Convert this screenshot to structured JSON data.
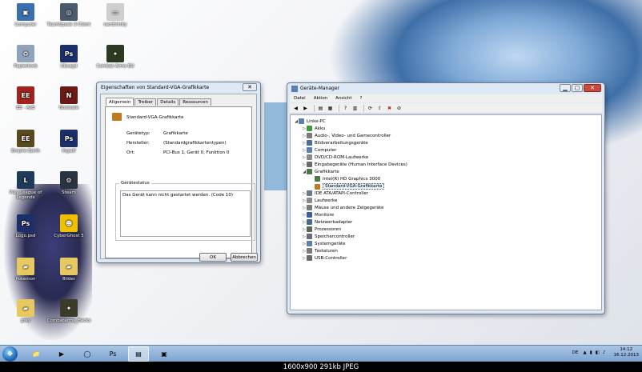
{
  "desktop": {
    "icons": [
      {
        "label": "Computer",
        "icon": "computer-icon",
        "color": "#3c6fb0",
        "glyph": "▣"
      },
      {
        "label": "TeamSpeak 3 Client",
        "icon": "teamspeak-icon",
        "color": "#4a5a6a",
        "glyph": "◎"
      },
      {
        "label": "nerdtrinity",
        "icon": "app-icon",
        "color": "#cfcfcf",
        "glyph": "▭"
      },
      {
        "label": "Papierkorb",
        "icon": "recycle-bin-icon",
        "color": "#8fa4bb",
        "glyph": "♻"
      },
      {
        "label": "Ubxsgd",
        "icon": "photoshop-file-icon",
        "color": "#1c2f6b",
        "glyph": "Ps"
      },
      {
        "label": "Combat Arms EU",
        "icon": "combat-arms-icon",
        "color": "#2d3a22",
        "glyph": "✦"
      },
      {
        "label": "EE - AoE",
        "icon": "empire-earth-icon",
        "color": "#a2231d",
        "glyph": "EE"
      },
      {
        "label": "Nosteale",
        "icon": "nostale-icon",
        "color": "#6a1a12",
        "glyph": "N"
      },
      {
        "label": "Empire Earth",
        "icon": "empire-earth-2-icon",
        "color": "#5a4a20",
        "glyph": "EE"
      },
      {
        "label": "Ihgsdf",
        "icon": "photoshop-file-icon",
        "color": "#1c2f6b",
        "glyph": "Ps"
      },
      {
        "label": "Play League of Legends",
        "icon": "league-of-legends-icon",
        "color": "#203a5a",
        "glyph": "L"
      },
      {
        "label": "Steam",
        "icon": "steam-icon",
        "color": "#2a3440",
        "glyph": "⚙"
      },
      {
        "label": "Logo.psd",
        "icon": "photoshop-file-icon",
        "color": "#1c2f6b",
        "glyph": "Ps"
      },
      {
        "label": "CyberGhost 5",
        "icon": "cyberghost-icon",
        "color": "#f0c000",
        "glyph": "☻"
      },
      {
        "label": "Pokemon",
        "icon": "folder-icon",
        "color": "#e8c860",
        "glyph": "▰"
      },
      {
        "label": "Bilder",
        "icon": "folder-icon",
        "color": "#e8c860",
        "glyph": "▰"
      },
      {
        "label": "grey",
        "icon": "folder-icon",
        "color": "#e8c860",
        "glyph": "▰"
      },
      {
        "label": "Combatarms_Hacks",
        "icon": "combat-arms-icon",
        "color": "#3b3b2a",
        "glyph": "✦"
      }
    ]
  },
  "props": {
    "title": "Eigenschaften von Standard-VGA-Grafikkarte",
    "close_glyph": "✕",
    "tabs": [
      "Allgemein",
      "Treiber",
      "Details",
      "Ressourcen"
    ],
    "device_name": "Standard-VGA-Grafikkarte",
    "rows": [
      {
        "key": "Gerätetyp:",
        "value": "Grafikkarte"
      },
      {
        "key": "Hersteller:",
        "value": "(Standardgrafikkartentypen)"
      },
      {
        "key": "Ort:",
        "value": "PCI-Bus 1, Gerät 0, Funktion 0"
      }
    ],
    "status_label": "Gerätestatus",
    "status_text": "Das Gerät kann nicht gestartet werden. (Code 10)",
    "ok_label": "OK",
    "cancel_label": "Abbrechen"
  },
  "devmgr": {
    "title": "Geräte-Manager",
    "min_glyph": "▁",
    "max_glyph": "▢",
    "close_glyph": "✕",
    "menu": [
      "Datei",
      "Aktion",
      "Ansicht",
      "?"
    ],
    "toolbar": [
      {
        "glyph": "◀",
        "icon": "back-icon"
      },
      {
        "glyph": "▶",
        "icon": "forward-icon"
      },
      {
        "glyph": "▤",
        "icon": "properties-icon"
      },
      {
        "glyph": "▦",
        "icon": "tree-icon"
      },
      {
        "glyph": "?",
        "icon": "help-icon"
      },
      {
        "glyph": "▥",
        "icon": "view-icon"
      },
      {
        "glyph": "⟳",
        "icon": "scan-icon"
      },
      {
        "glyph": "⇧",
        "icon": "update-driver-icon"
      },
      {
        "glyph": "✖",
        "icon": "uninstall-icon"
      },
      {
        "glyph": "⊘",
        "icon": "disable-icon"
      }
    ],
    "tree": [
      {
        "label": "Linke-PC",
        "level": 0,
        "arrow": "◢",
        "color": "#5a7fb0",
        "icon": "computer-icon"
      },
      {
        "label": "Akku",
        "level": 1,
        "arrow": "▷",
        "color": "#3b9b3b",
        "icon": "battery-icon"
      },
      {
        "label": "Audio-, Video- und Gamecontroller",
        "level": 1,
        "arrow": "▷",
        "color": "#7a7a7a",
        "icon": "speaker-icon"
      },
      {
        "label": "Bildverarbeitungsgeräte",
        "level": 1,
        "arrow": "▷",
        "color": "#4a6f9a",
        "icon": "camera-icon"
      },
      {
        "label": "Computer",
        "level": 1,
        "arrow": "▷",
        "color": "#5a7fb0",
        "icon": "computer-icon"
      },
      {
        "label": "DVD/CD-ROM-Laufwerke",
        "level": 1,
        "arrow": "▷",
        "color": "#8a8a8a",
        "icon": "dvd-drive-icon"
      },
      {
        "label": "Eingabegeräte (Human Interface Devices)",
        "level": 1,
        "arrow": "▷",
        "color": "#6a6a6a",
        "icon": "hid-icon"
      },
      {
        "label": "Grafikkarte",
        "level": 1,
        "arrow": "◢",
        "color": "#4a7a4a",
        "icon": "display-adapter-icon"
      },
      {
        "label": "Intel(R) HD Graphics 3000",
        "level": 2,
        "arrow": "",
        "color": "#4a7a4a",
        "icon": "display-adapter-icon"
      },
      {
        "label": "Standard-VGA-Grafikkarte",
        "level": 2,
        "arrow": "",
        "color": "#c07a20",
        "icon": "warning-device-icon"
      },
      {
        "label": "IDE ATA/ATAPI-Controller",
        "level": 1,
        "arrow": "▷",
        "color": "#6a7a8a",
        "icon": "ide-controller-icon"
      },
      {
        "label": "Laufwerke",
        "level": 1,
        "arrow": "▷",
        "color": "#8a8a8a",
        "icon": "disk-drive-icon"
      },
      {
        "label": "Mäuse und andere Zeigegeräte",
        "level": 1,
        "arrow": "▷",
        "color": "#7a7a7a",
        "icon": "mouse-icon"
      },
      {
        "label": "Monitore",
        "level": 1,
        "arrow": "▷",
        "color": "#3a5f9a",
        "icon": "monitor-icon"
      },
      {
        "label": "Netzwerkadapter",
        "level": 1,
        "arrow": "▷",
        "color": "#4a6a8a",
        "icon": "network-adapter-icon"
      },
      {
        "label": "Prozessoren",
        "level": 1,
        "arrow": "▷",
        "color": "#5a6a5a",
        "icon": "processor-icon"
      },
      {
        "label": "Speichercontroller",
        "level": 1,
        "arrow": "▷",
        "color": "#6a6a7a",
        "icon": "storage-controller-icon"
      },
      {
        "label": "Systemgeräte",
        "level": 1,
        "arrow": "▷",
        "color": "#5a7fb0",
        "icon": "system-device-icon"
      },
      {
        "label": "Tastaturen",
        "level": 1,
        "arrow": "▷",
        "color": "#7a7a7a",
        "icon": "keyboard-icon"
      },
      {
        "label": "USB-Controller",
        "level": 1,
        "arrow": "▷",
        "color": "#6a6a6a",
        "icon": "usb-icon"
      }
    ]
  },
  "taskbar": {
    "start_glyph": "❖",
    "apps": [
      {
        "glyph": "📁",
        "icon": "explorer-icon",
        "active": false
      },
      {
        "glyph": "▶",
        "icon": "media-player-icon",
        "active": false
      },
      {
        "glyph": "◯",
        "icon": "browser-icon",
        "active": false
      },
      {
        "glyph": "Ps",
        "icon": "photoshop-icon",
        "active": false
      },
      {
        "glyph": "▤",
        "icon": "device-manager-icon",
        "active": true
      },
      {
        "glyph": "▣",
        "icon": "paint-icon",
        "active": false
      }
    ],
    "lang": "DE",
    "tray_glyphs": [
      "▲",
      "▮",
      "◧",
      "♪"
    ],
    "time": "14:12",
    "date": "16.12.2013"
  },
  "image_caption": "1600x900  291kb  JPEG"
}
